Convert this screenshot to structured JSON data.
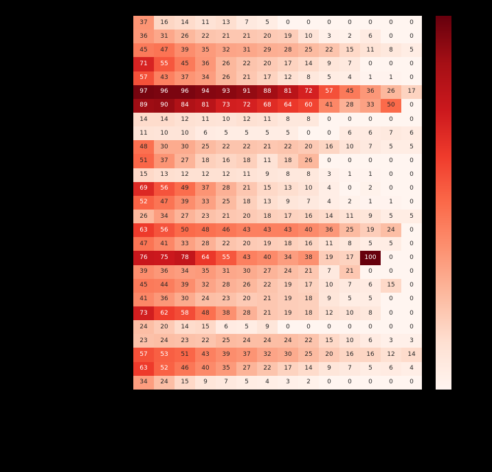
{
  "chart_data": {
    "type": "heatmap",
    "rows": 27,
    "cols": 14,
    "cmap": "Reds",
    "vmin": 0,
    "vmax": 100,
    "values": [
      [
        37,
        16,
        14,
        11,
        13,
        7,
        5,
        0,
        0,
        0,
        0,
        0,
        0,
        0
      ],
      [
        36,
        31,
        26,
        22,
        21,
        21,
        20,
        19,
        10,
        3,
        2,
        6,
        0,
        0
      ],
      [
        45,
        47,
        39,
        35,
        32,
        31,
        29,
        28,
        25,
        22,
        15,
        11,
        8,
        5
      ],
      [
        71,
        55,
        45,
        36,
        26,
        22,
        20,
        17,
        14,
        9,
        7,
        0,
        0,
        0
      ],
      [
        57,
        43,
        37,
        34,
        26,
        21,
        17,
        12,
        8,
        5,
        4,
        1,
        1,
        0
      ],
      [
        97,
        96,
        96,
        94,
        93,
        91,
        88,
        81,
        72,
        57,
        45,
        36,
        26,
        17
      ],
      [
        89,
        90,
        84,
        81,
        73,
        72,
        68,
        64,
        60,
        41,
        28,
        33,
        50,
        0
      ],
      [
        14,
        14,
        12,
        11,
        10,
        12,
        11,
        8,
        8,
        0,
        0,
        0,
        0,
        0
      ],
      [
        11,
        10,
        10,
        6,
        5,
        5,
        5,
        5,
        0,
        0,
        6,
        6,
        7,
        6
      ],
      [
        48,
        30,
        30,
        25,
        22,
        22,
        21,
        22,
        20,
        16,
        10,
        7,
        5,
        5
      ],
      [
        51,
        37,
        27,
        18,
        16,
        18,
        11,
        18,
        26,
        0,
        0,
        0,
        0,
        0
      ],
      [
        15,
        13,
        12,
        12,
        12,
        11,
        9,
        8,
        8,
        3,
        1,
        1,
        0,
        0
      ],
      [
        69,
        56,
        49,
        37,
        28,
        21,
        15,
        13,
        10,
        4,
        0,
        2,
        0,
        0
      ],
      [
        52,
        47,
        39,
        33,
        25,
        18,
        13,
        9,
        7,
        4,
        2,
        1,
        1,
        0
      ],
      [
        26,
        34,
        27,
        23,
        21,
        20,
        18,
        17,
        16,
        14,
        11,
        9,
        5,
        5
      ],
      [
        63,
        56,
        50,
        48,
        46,
        43,
        43,
        43,
        40,
        36,
        25,
        19,
        24,
        0
      ],
      [
        47,
        41,
        33,
        28,
        22,
        20,
        19,
        18,
        16,
        11,
        8,
        5,
        5,
        0
      ],
      [
        76,
        75,
        78,
        64,
        55,
        43,
        40,
        34,
        38,
        19,
        17,
        100,
        0,
        0
      ],
      [
        39,
        36,
        34,
        35,
        31,
        30,
        27,
        24,
        21,
        7,
        21,
        0,
        0,
        0
      ],
      [
        45,
        44,
        39,
        32,
        28,
        26,
        22,
        19,
        17,
        10,
        7,
        6,
        15,
        0
      ],
      [
        41,
        36,
        30,
        24,
        23,
        20,
        21,
        19,
        18,
        9,
        5,
        5,
        0,
        0
      ],
      [
        73,
        62,
        58,
        48,
        38,
        28,
        21,
        19,
        18,
        12,
        10,
        8,
        0,
        0
      ],
      [
        24,
        20,
        14,
        15,
        6,
        5,
        9,
        0,
        0,
        0,
        0,
        0,
        0,
        0
      ],
      [
        23,
        24,
        23,
        22,
        25,
        24,
        24,
        24,
        22,
        15,
        10,
        6,
        3,
        3
      ],
      [
        57,
        53,
        51,
        43,
        39,
        37,
        32,
        30,
        25,
        20,
        16,
        16,
        12,
        14
      ],
      [
        63,
        52,
        46,
        40,
        35,
        27,
        22,
        17,
        14,
        9,
        7,
        5,
        6,
        4
      ],
      [
        34,
        24,
        15,
        9,
        7,
        5,
        4,
        3,
        2,
        0,
        0,
        0,
        0,
        0
      ]
    ]
  }
}
